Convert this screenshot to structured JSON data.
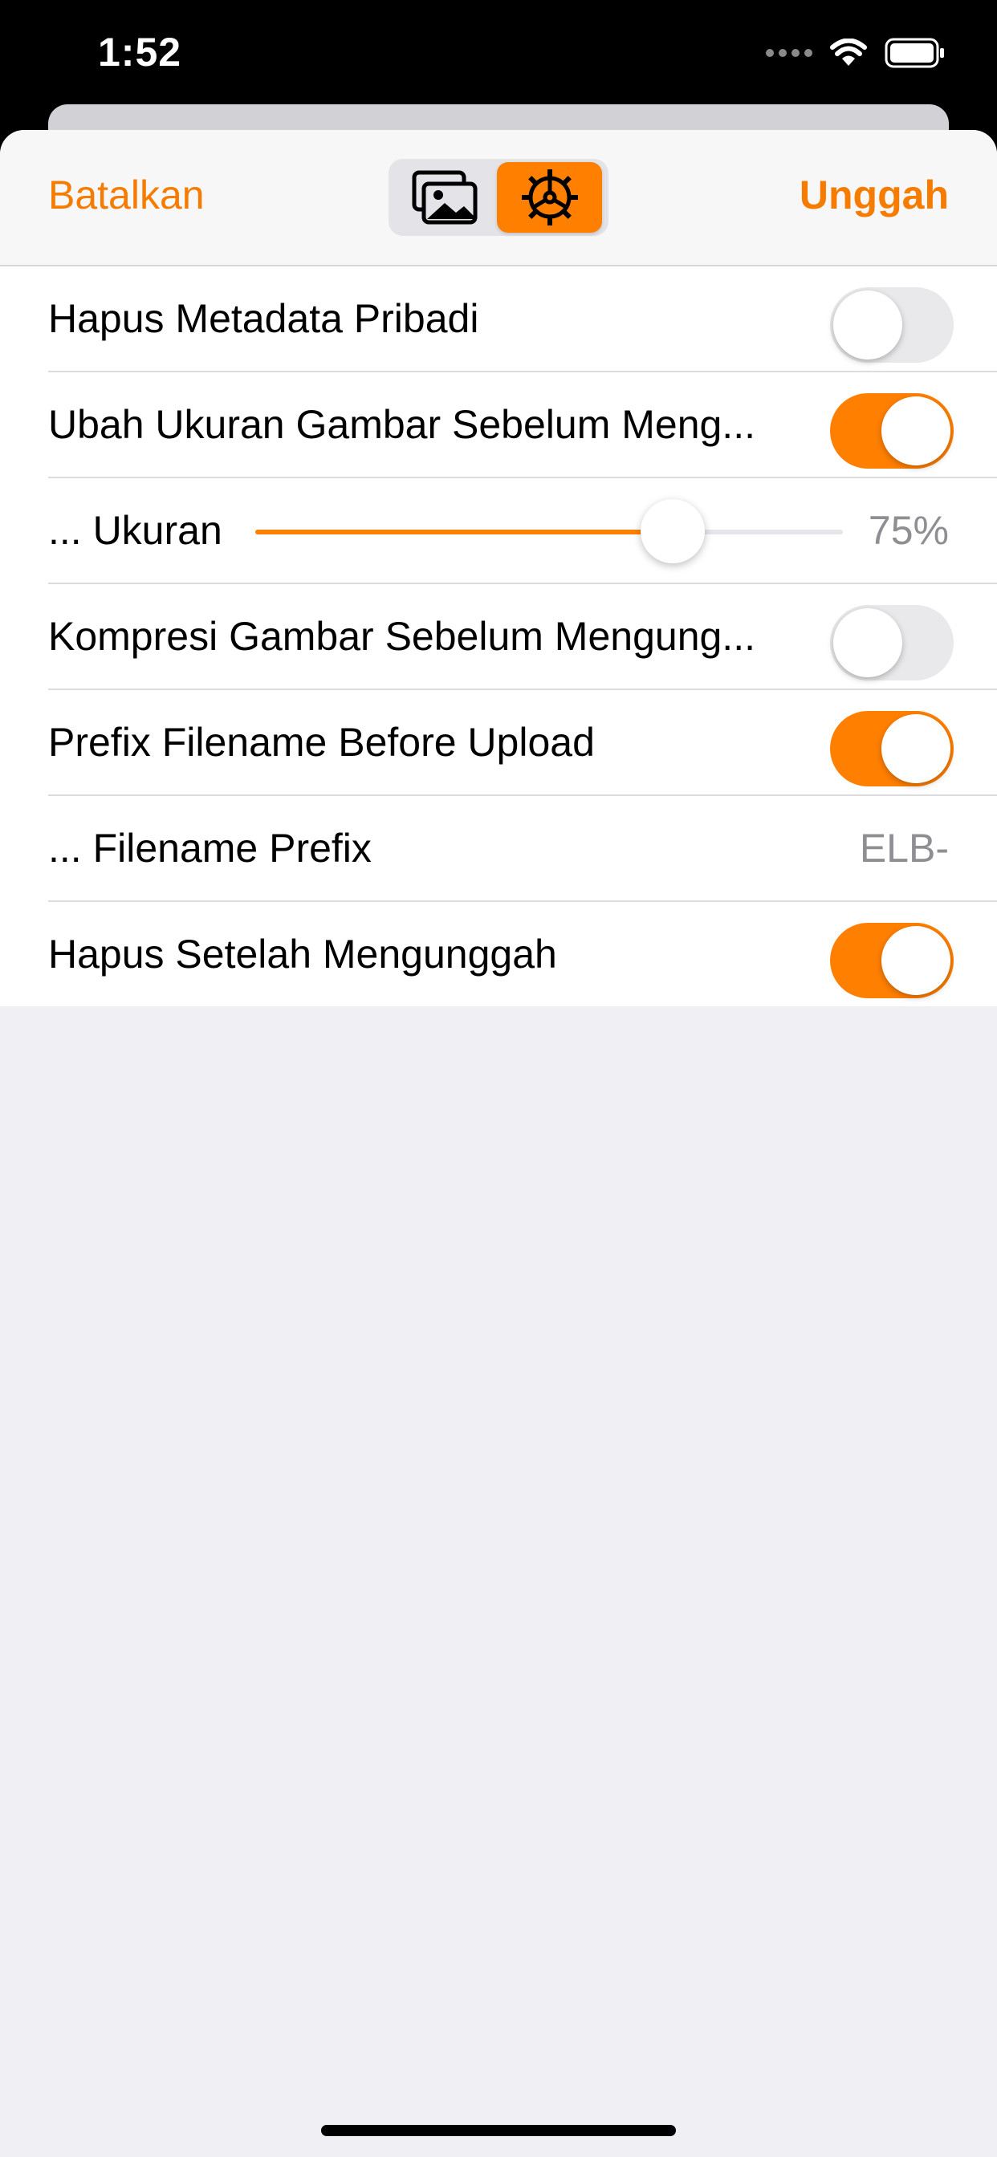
{
  "status_bar": {
    "time": "1:52"
  },
  "nav": {
    "cancel_label": "Batalkan",
    "upload_label": "Unggah",
    "segments": [
      {
        "icon": "photos-icon",
        "active": false
      },
      {
        "icon": "gear-icon",
        "active": true
      }
    ]
  },
  "settings": {
    "rows": [
      {
        "label": "Hapus Metadata Pribadi",
        "type": "toggle",
        "on": false
      },
      {
        "label": "Ubah Ukuran Gambar Sebelum Meng...",
        "type": "toggle",
        "on": true
      },
      {
        "label": "... Ukuran",
        "type": "slider",
        "value_label": "75%",
        "fraction": 0.71
      },
      {
        "label": "Kompresi Gambar Sebelum Mengung...",
        "type": "toggle",
        "on": false
      },
      {
        "label": "Prefix Filename Before Upload",
        "type": "toggle",
        "on": true
      },
      {
        "label": "... Filename Prefix",
        "type": "value",
        "value_label": "ELB-"
      },
      {
        "label": "Hapus Setelah Mengunggah",
        "type": "toggle",
        "on": true
      }
    ]
  },
  "colors": {
    "accent": "#ff7f00",
    "background": "#efeff4"
  }
}
